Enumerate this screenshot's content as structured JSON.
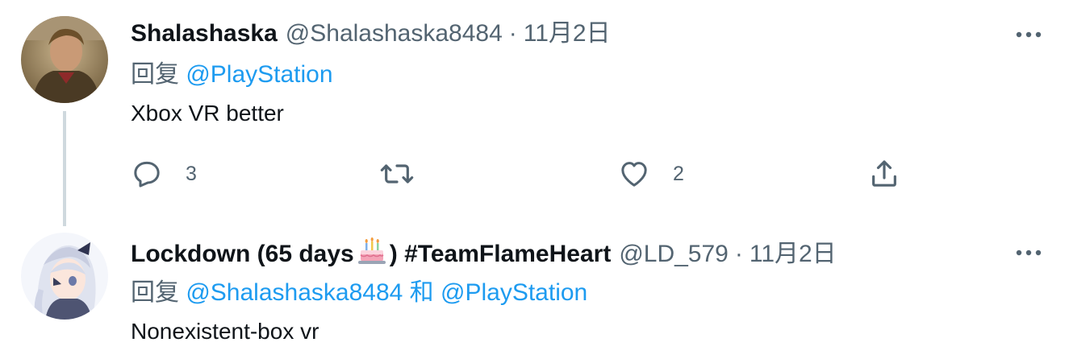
{
  "tweets": [
    {
      "author": {
        "display_name": "Shalashaska",
        "handle": "@Shalashaska8484",
        "avatar_icon": "user-avatar"
      },
      "date": "11月2日",
      "reply": {
        "prefix": "回复",
        "mentions": [
          "@PlayStation"
        ]
      },
      "text": "Xbox VR better",
      "stats": {
        "replies": "3",
        "retweets": "",
        "likes": "2"
      }
    },
    {
      "author": {
        "display_name_prefix": "Lockdown (65 days",
        "display_name_emoji": "birthday-cake-icon",
        "display_name_suffix": ") #TeamFlameHeart",
        "handle": "@LD_579",
        "avatar_icon": "anime-avatar"
      },
      "date": "11月2日",
      "reply": {
        "prefix": "回复",
        "mentions": [
          "@Shalashaska8484",
          "@PlayStation"
        ],
        "conjunction": "和"
      },
      "text": "Nonexistent-box vr"
    }
  ],
  "separator": "·",
  "colors": {
    "text_primary": "#0f1419",
    "text_secondary": "#536471",
    "link": "#1d9bf0",
    "thread_line": "#cfd9de"
  }
}
